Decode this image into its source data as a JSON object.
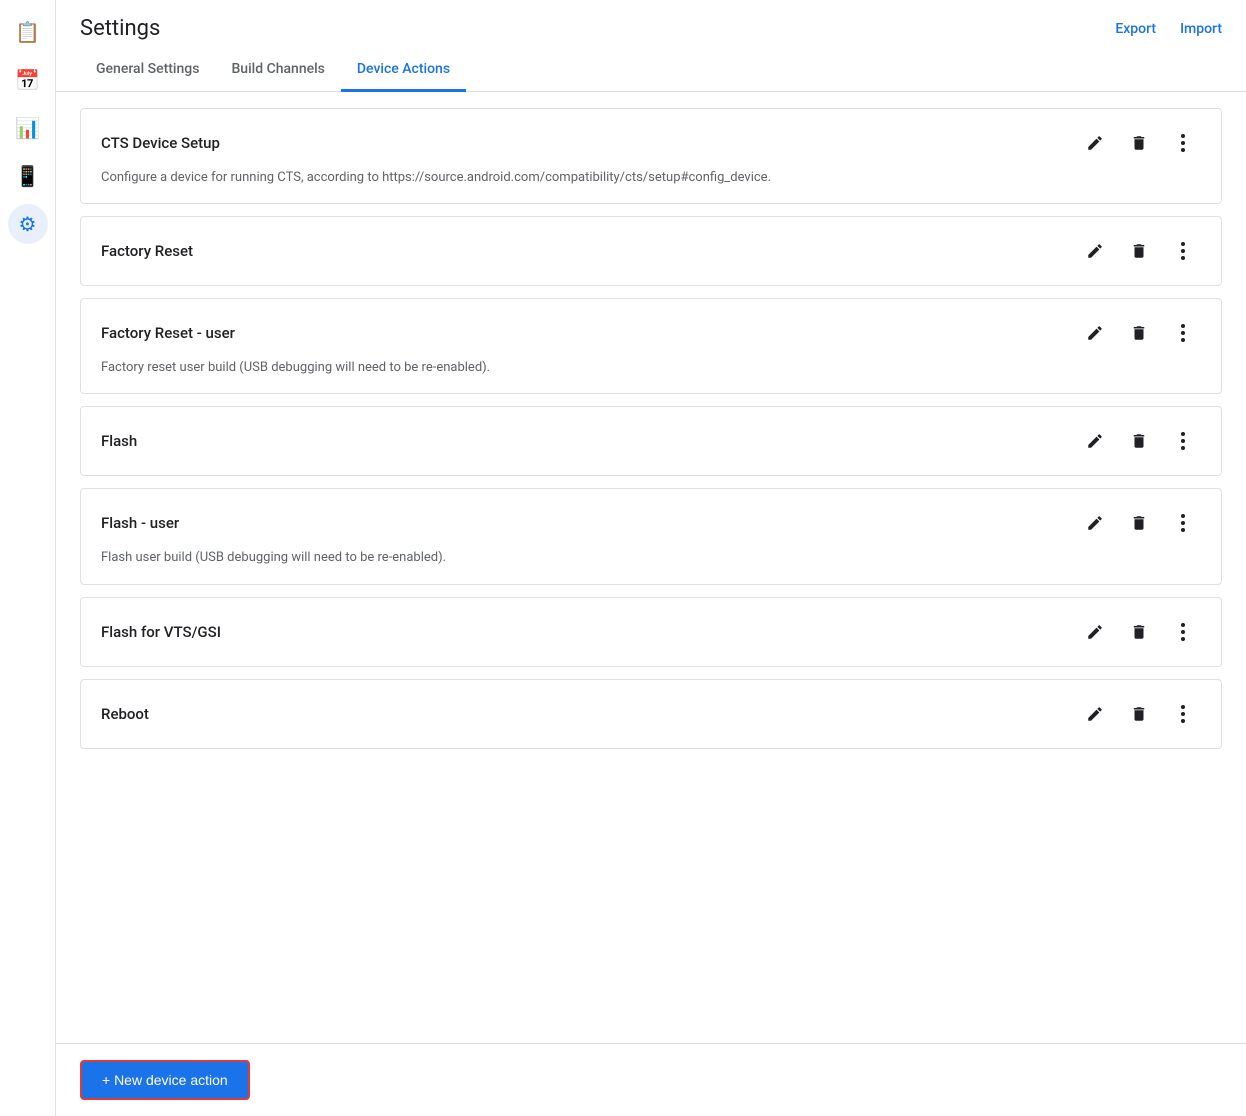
{
  "header": {
    "title": "Settings",
    "export_label": "Export",
    "import_label": "Import"
  },
  "tabs": [
    {
      "id": "general",
      "label": "General Settings",
      "active": false
    },
    {
      "id": "build-channels",
      "label": "Build Channels",
      "active": false
    },
    {
      "id": "device-actions",
      "label": "Device Actions",
      "active": true
    }
  ],
  "sidebar": {
    "items": [
      {
        "id": "clipboard",
        "icon": "📋",
        "active": false
      },
      {
        "id": "calendar",
        "icon": "📅",
        "active": false
      },
      {
        "id": "chart",
        "icon": "📊",
        "active": false
      },
      {
        "id": "phone",
        "icon": "📱",
        "active": false
      },
      {
        "id": "settings",
        "icon": "⚙",
        "active": true
      }
    ]
  },
  "actions": [
    {
      "id": "cts-device-setup",
      "name": "CTS Device Setup",
      "description": "Configure a device for running CTS, according to https://source.android.com/compatibility/cts/setup#config_device."
    },
    {
      "id": "factory-reset",
      "name": "Factory Reset",
      "description": ""
    },
    {
      "id": "factory-reset-user",
      "name": "Factory Reset - user",
      "description": "Factory reset user build (USB debugging will need to be re-enabled)."
    },
    {
      "id": "flash",
      "name": "Flash",
      "description": ""
    },
    {
      "id": "flash-user",
      "name": "Flash - user",
      "description": "Flash user build (USB debugging will need to be re-enabled)."
    },
    {
      "id": "flash-vts-gsi",
      "name": "Flash for VTS/GSI",
      "description": ""
    },
    {
      "id": "reboot",
      "name": "Reboot",
      "description": ""
    }
  ],
  "footer": {
    "new_action_label": "+ New device action"
  }
}
